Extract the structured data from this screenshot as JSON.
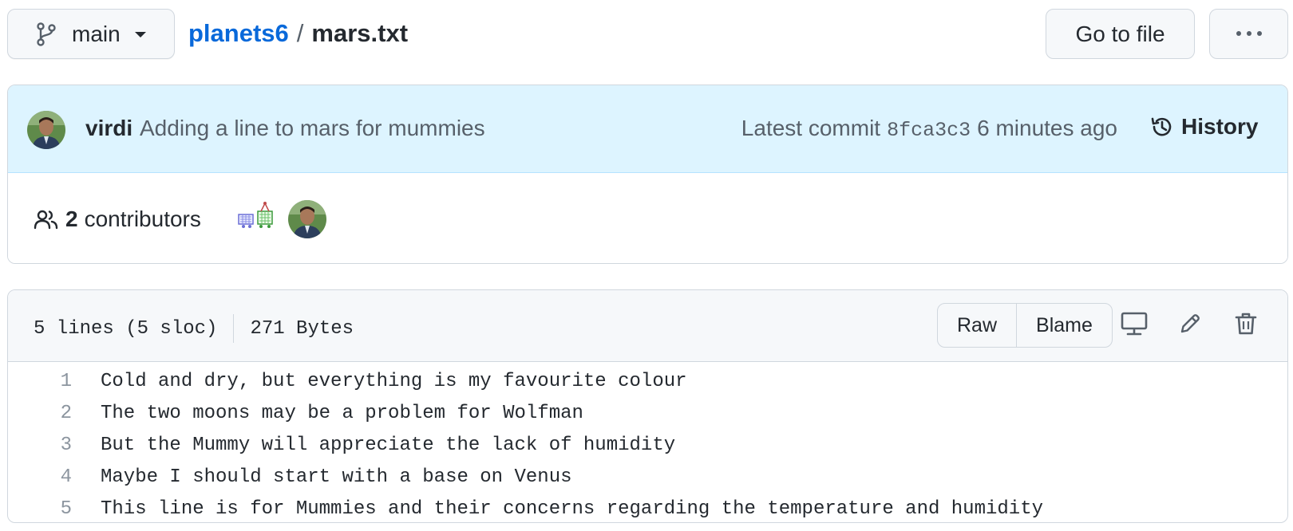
{
  "header": {
    "branch": "main",
    "repo": "planets6",
    "separator": "/",
    "file": "mars.txt",
    "goto_label": "Go to file",
    "more_icon": "kebab-horizontal-icon"
  },
  "commit": {
    "author": "virdi",
    "message": "Adding a line to mars for mummies",
    "latest_label": "Latest commit",
    "sha": "8fca3c3",
    "time": "6 minutes ago",
    "history_label": "History"
  },
  "contributors": {
    "count": "2",
    "label": "contributors"
  },
  "file_meta": {
    "lines": "5 lines (5 sloc)",
    "size": "271 Bytes",
    "raw_label": "Raw",
    "blame_label": "Blame"
  },
  "code_lines": [
    {
      "num": "1",
      "text": "Cold and dry, but everything is my favourite colour"
    },
    {
      "num": "2",
      "text": "The two moons may be a problem for Wolfman"
    },
    {
      "num": "3",
      "text": "But the Mummy will appreciate the lack of humidity"
    },
    {
      "num": "4",
      "text": "Maybe I should start with a base on Venus"
    },
    {
      "num": "5",
      "text": "This line is for Mummies and their concerns regarding the temperature and humidity"
    }
  ],
  "colors": {
    "link": "#0969da",
    "commit_bg": "#ddf4ff",
    "header_bg": "#f6f8fa",
    "border": "#d0d7de"
  }
}
